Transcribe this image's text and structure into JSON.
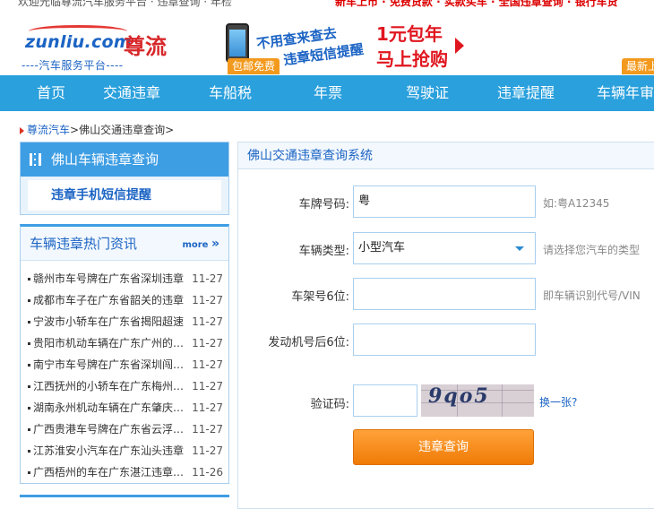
{
  "topbar": {
    "left_text": "欢迎光临尊流汽车服务平台 · 违章查询 · 年检",
    "right_text": "新车上市 · 免费贷款 · 实款买车 · 全国违章查询 · 银行车贷"
  },
  "logo": {
    "word": "zunliu.com",
    "cn": "尊流",
    "sub": "----汽车服务平台----"
  },
  "ad": {
    "line1": "不用查来查去",
    "line2": "违章短信提醒",
    "price1": "1元包年",
    "price2": "马上抢购",
    "tag": "包邮免费"
  },
  "corner_tag": "最新上线",
  "nav": {
    "items": [
      "首页",
      "交通违章",
      "车船税",
      "年票",
      "驾驶证",
      "违章提醒",
      "车辆年审"
    ]
  },
  "breadcrumb": {
    "home": "尊流汽车",
    "current": "佛山交通违章查询",
    "sep": ">"
  },
  "sidebar": {
    "title": "佛山车辆违章查询",
    "link": "违章手机短信提醒"
  },
  "news": {
    "title": "车辆违章热门资讯",
    "more": "more",
    "items": [
      {
        "text": "赣州市车号牌在广东省深圳违章",
        "date": "11-27"
      },
      {
        "text": "成都市车子在广东省韶关的违章",
        "date": "11-27"
      },
      {
        "text": "宁波市小轿车在广东省揭阳超速",
        "date": "11-27"
      },
      {
        "text": "贵阳市机动车辆在广东广州的违章",
        "date": "11-27"
      },
      {
        "text": "南宁市车号牌在广东省深圳闯红灯",
        "date": "11-27"
      },
      {
        "text": "江西抚州的小轿车在广东梅州违章",
        "date": "11-27"
      },
      {
        "text": "湖南永州机动车辆在广东肇庆违章",
        "date": "11-27"
      },
      {
        "text": "广西贵港车号牌在广东省云浮违章",
        "date": "11-27"
      },
      {
        "text": "江苏淮安小汽车在广东汕头违章",
        "date": "11-27"
      },
      {
        "text": "广西梧州的车在广东湛江违章查询",
        "date": "11-26"
      }
    ]
  },
  "form": {
    "title": "佛山交通违章查询系统",
    "plate_label": "车牌号码:",
    "plate_value": "粤",
    "plate_hint": "如:粤A12345",
    "type_label": "车辆类型:",
    "type_value": "小型汽车",
    "type_hint": "请选择您汽车的类型",
    "frame_label": "车架号6位:",
    "frame_value": "",
    "frame_hint": "即车辆识别代号/VIN",
    "engine_label": "发动机号后6位:",
    "engine_value": "",
    "captcha_label": "验证码:",
    "captcha_value": "",
    "captcha_text": "9qo5",
    "refresh": "换一张?",
    "submit": "违章查询"
  },
  "colors": {
    "nav_bg": "#2aa0dd",
    "accent_blue": "#1c64c4",
    "button_orange": "#f07b06",
    "tag_orange": "#f39a1e"
  }
}
